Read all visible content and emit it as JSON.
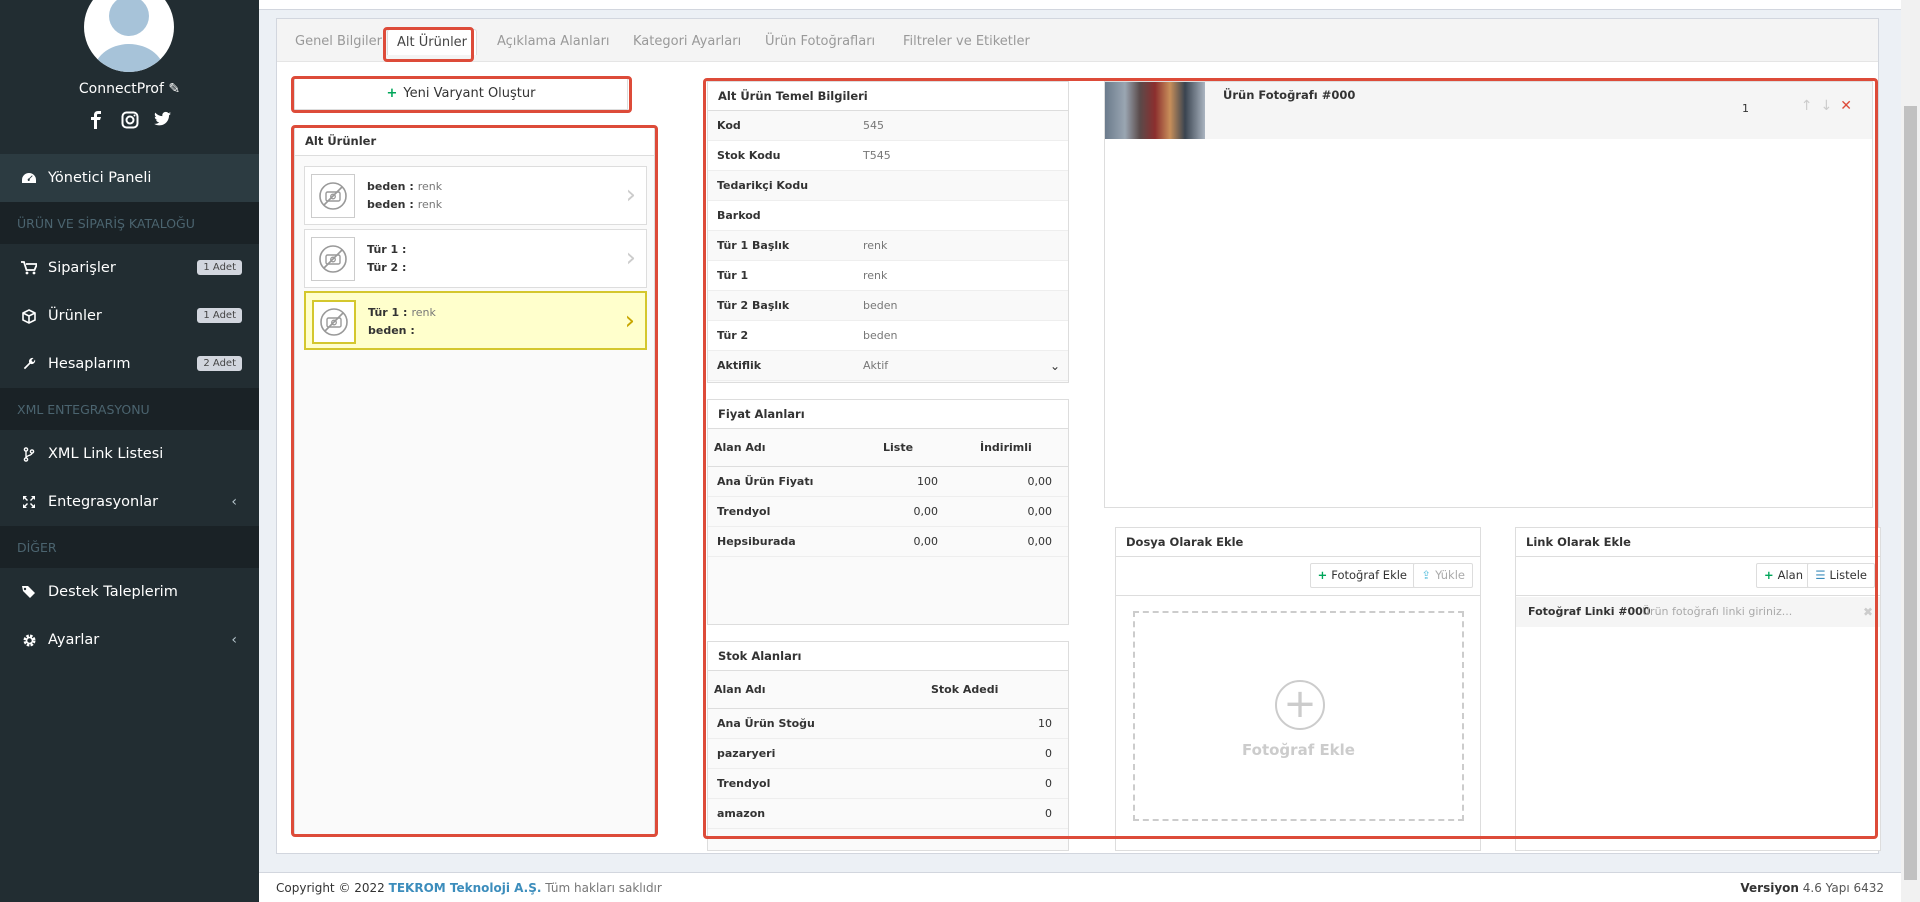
{
  "sidebar": {
    "username": "ConnectProf",
    "items": {
      "dashboard": "Yönetici Paneli",
      "header1": "ÜRÜN VE SİPARİŞ KATALOĞU",
      "orders": "Siparişler",
      "orders_badge": "1 Adet",
      "products": "Ürünler",
      "products_badge": "1 Adet",
      "accounts": "Hesaplarım",
      "accounts_badge": "2 Adet",
      "header2": "XML ENTEGRASYONU",
      "xml_links": "XML Link Listesi",
      "integrations": "Entegrasyonlar",
      "header3": "DİĞER",
      "support": "Destek Taleplerim",
      "settings": "Ayarlar"
    }
  },
  "tabs": [
    "Genel Bilgiler",
    "Alt Ürünler",
    "Açıklama Alanları",
    "Kategori Ayarları",
    "Ürün Fotoğrafları",
    "Filtreler ve Etiketler"
  ],
  "new_variant_label": "Yeni Varyant Oluştur",
  "variants": {
    "title": "Alt Ürünler",
    "items": [
      {
        "k1": "beden :",
        "v1": "renk",
        "k2": "beden :",
        "v2": "renk"
      },
      {
        "k1": "Tür 1 :",
        "v1": "",
        "k2": "Tür 2 :",
        "v2": ""
      },
      {
        "k1": "Tür 1 :",
        "v1": "renk",
        "k2": "beden :",
        "v2": ""
      }
    ]
  },
  "basic_info": {
    "title": "Alt Ürün Temel Bilgileri",
    "rows": [
      {
        "k": "Kod",
        "v": "545"
      },
      {
        "k": "Stok Kodu",
        "v": "T545"
      },
      {
        "k": "Tedarikçi Kodu",
        "v": ""
      },
      {
        "k": "Barkod",
        "v": ""
      },
      {
        "k": "Tür 1 Başlık",
        "v": "renk"
      },
      {
        "k": "Tür 1",
        "v": "renk"
      },
      {
        "k": "Tür 2 Başlık",
        "v": "beden"
      },
      {
        "k": "Tür 2",
        "v": "beden"
      },
      {
        "k": "Aktiflik",
        "v": "Aktif"
      }
    ]
  },
  "prices": {
    "title": "Fiyat Alanları",
    "headers": [
      "Alan Adı",
      "Liste",
      "İndirimli"
    ],
    "rows": [
      {
        "name": "Ana Ürün Fiyatı",
        "list": "100",
        "disc": "0,00"
      },
      {
        "name": "Trendyol",
        "list": "0,00",
        "disc": "0,00"
      },
      {
        "name": "Hepsiburada",
        "list": "0,00",
        "disc": "0,00"
      }
    ]
  },
  "stock": {
    "title": "Stok Alanları",
    "headers": [
      "Alan Adı",
      "Stok Adedi"
    ],
    "rows": [
      {
        "name": "Ana Ürün Stoğu",
        "qty": "10"
      },
      {
        "name": "pazaryeri",
        "qty": "0"
      },
      {
        "name": "Trendyol",
        "qty": "0"
      },
      {
        "name": "amazon",
        "qty": "0"
      }
    ]
  },
  "photo": {
    "title": "Ürün Fotoğrafı #000",
    "order": "1"
  },
  "file_add": {
    "title": "Dosya Olarak Ekle",
    "add_btn": "Fotoğraf Ekle",
    "upload_btn": "Yükle",
    "drop_text": "Fotoğraf Ekle"
  },
  "link_add": {
    "title": "Link Olarak Ekle",
    "field_btn": "Alan",
    "list_btn": "Listele",
    "row_label": "Fotoğraf Linki #000",
    "row_placeholder": "Ürün fotoğrafı linki giriniz..."
  },
  "footer": {
    "copyright": "Copyright © 2022",
    "company": "TEKROM Teknoloji A.Ş.",
    "rights": "Tüm hakları saklıdır",
    "version_label": "Versiyon",
    "version": "4.6 Yapı 6432"
  },
  "colors": {
    "accent_red": "#dd4b39",
    "sidebar_bg": "#222d32",
    "green": "#00a65a",
    "link_blue": "#3c8dbc",
    "selected_yellow": "#ffffcc"
  }
}
